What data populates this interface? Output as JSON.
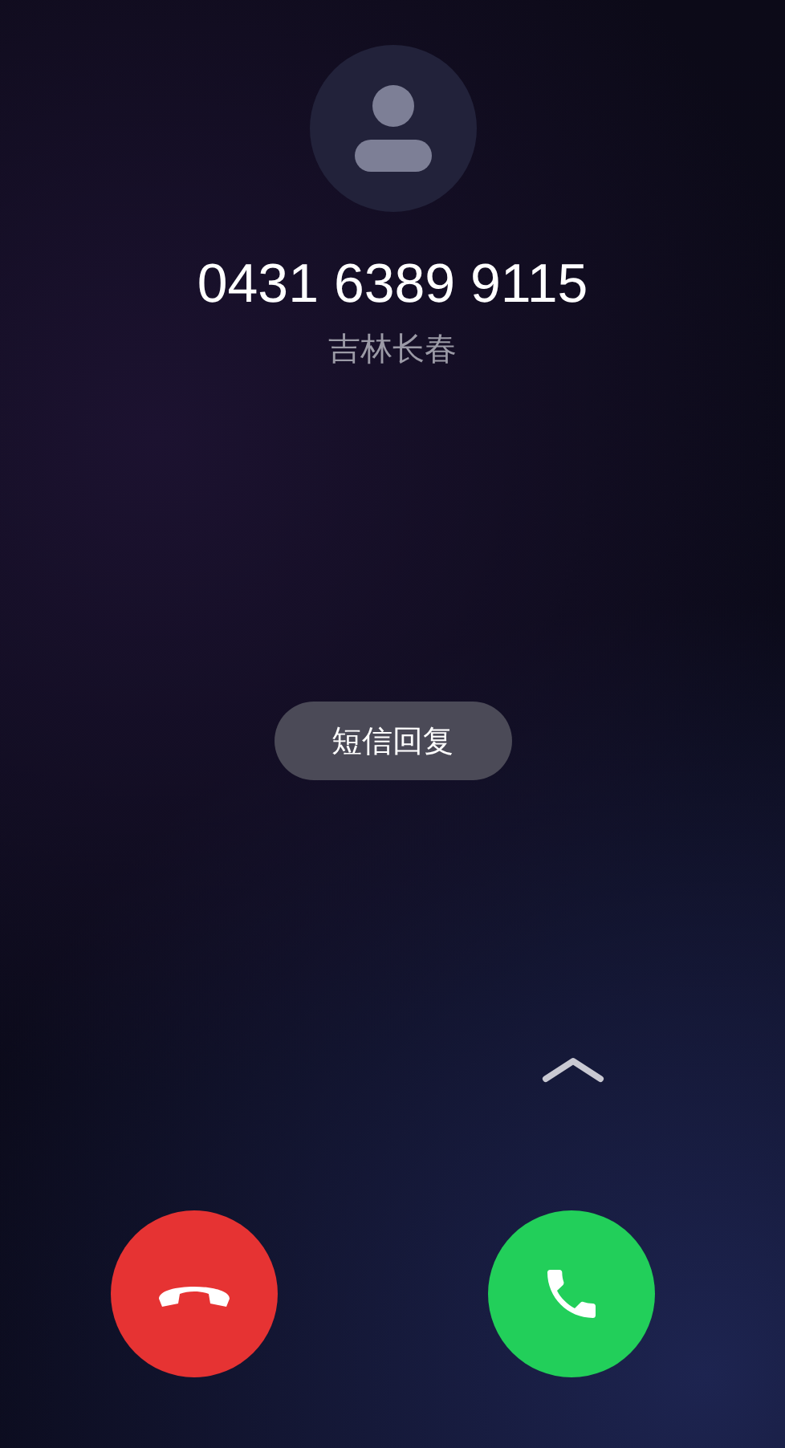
{
  "caller": {
    "number": "0431 6389 9115",
    "location": "吉林长春"
  },
  "quick_reply": {
    "label": "短信回复"
  }
}
